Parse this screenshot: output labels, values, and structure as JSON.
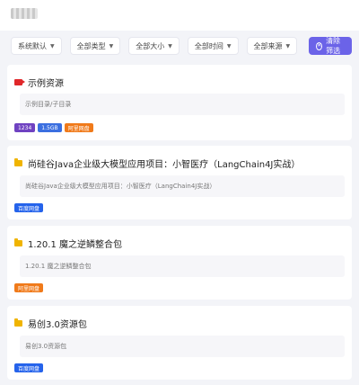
{
  "filters": [
    {
      "label": "系统默认"
    },
    {
      "label": "全部类型"
    },
    {
      "label": "全部大小"
    },
    {
      "label": "全部时间"
    },
    {
      "label": "全部来源"
    }
  ],
  "clear_button": {
    "label": "清除筛选"
  },
  "colors": {
    "accent": "#6b63e8",
    "tag_purple": "#6f42c1",
    "tag_blue": "#3b6fe0",
    "tag_orange": "#f07a1a",
    "tag_baidu": "#2563eb",
    "folder": "#f0b400",
    "video": "#e0272a"
  },
  "resources": [
    {
      "title": "示例资源",
      "icon": "video-icon",
      "description": "示例目录/子目录",
      "tags": [
        {
          "text": "1234",
          "color": "#6f42c1"
        },
        {
          "text": "1.5GB",
          "color": "#3b6fe0"
        },
        {
          "text": "阿里网盘",
          "color": "#f07a1a"
        }
      ]
    },
    {
      "title": "尚硅谷Java企业级大模型应用项目：小智医疗（LangChain4J实战）",
      "icon": "folder-icon",
      "description": "尚硅谷Java企业级大模型应用项目：小智医疗（LangChain4J实战）",
      "tags": [
        {
          "text": "百度网盘",
          "color": "#2563eb"
        }
      ]
    },
    {
      "title": "1.20.1 魔之逆鳞整合包",
      "icon": "folder-icon",
      "description": "1.20.1 魔之逆鳞整合包",
      "tags": [
        {
          "text": "阿里网盘",
          "color": "#f07a1a"
        }
      ]
    },
    {
      "title": "易创3.0资源包",
      "icon": "folder-icon",
      "description": "易创3.0资源包",
      "tags": [
        {
          "text": "百度网盘",
          "color": "#2563eb"
        }
      ]
    }
  ]
}
